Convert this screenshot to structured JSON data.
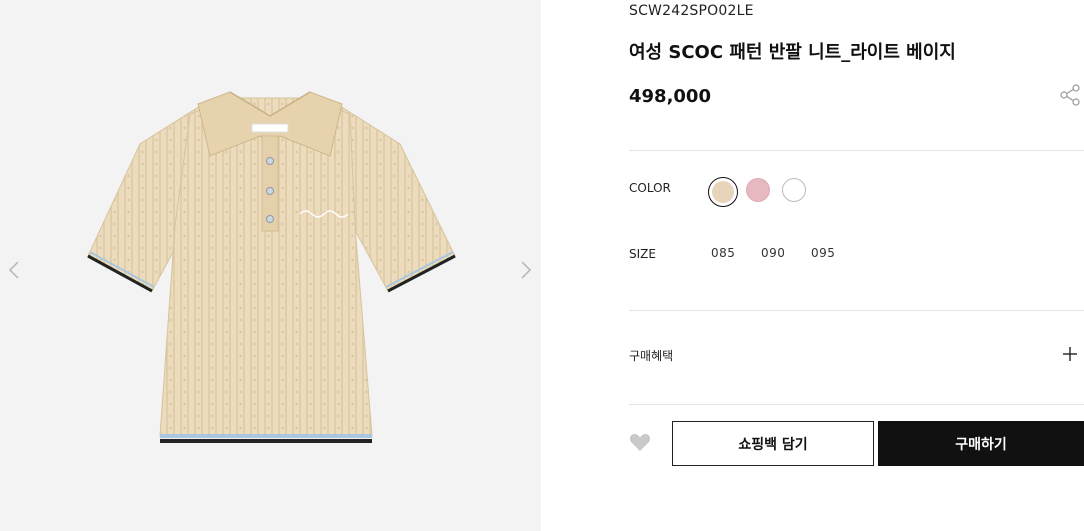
{
  "gallery": {
    "prev_icon": "chevron-left-icon",
    "next_icon": "chevron-right-icon",
    "image": "beige-knit-polo-shirt"
  },
  "product": {
    "code": "SCW242SPO02LE",
    "title": "여성 SCOC 패턴 반팔 니트_라이트 베이지",
    "price": "498,000",
    "share_icon": "share-icon"
  },
  "options": {
    "color_label": "COLOR",
    "colors": [
      {
        "name": "light-beige",
        "hex": "#e7d4bb",
        "selected": true
      },
      {
        "name": "pink",
        "hex": "#e5b9bf",
        "selected": false
      },
      {
        "name": "white",
        "hex": "#ffffff",
        "selected": false
      }
    ],
    "size_label": "SIZE",
    "sizes": [
      "085",
      "090",
      "095"
    ]
  },
  "benefit": {
    "label": "구매혜택",
    "expand_icon": "plus-icon"
  },
  "actions": {
    "wishlist_icon": "heart-icon",
    "cart_label": "쇼핑백 담기",
    "buy_label": "구매하기"
  },
  "colors": {
    "gallery_bg": "#f3f3f3",
    "primary": "#111111",
    "divider": "#e6e6e6"
  }
}
